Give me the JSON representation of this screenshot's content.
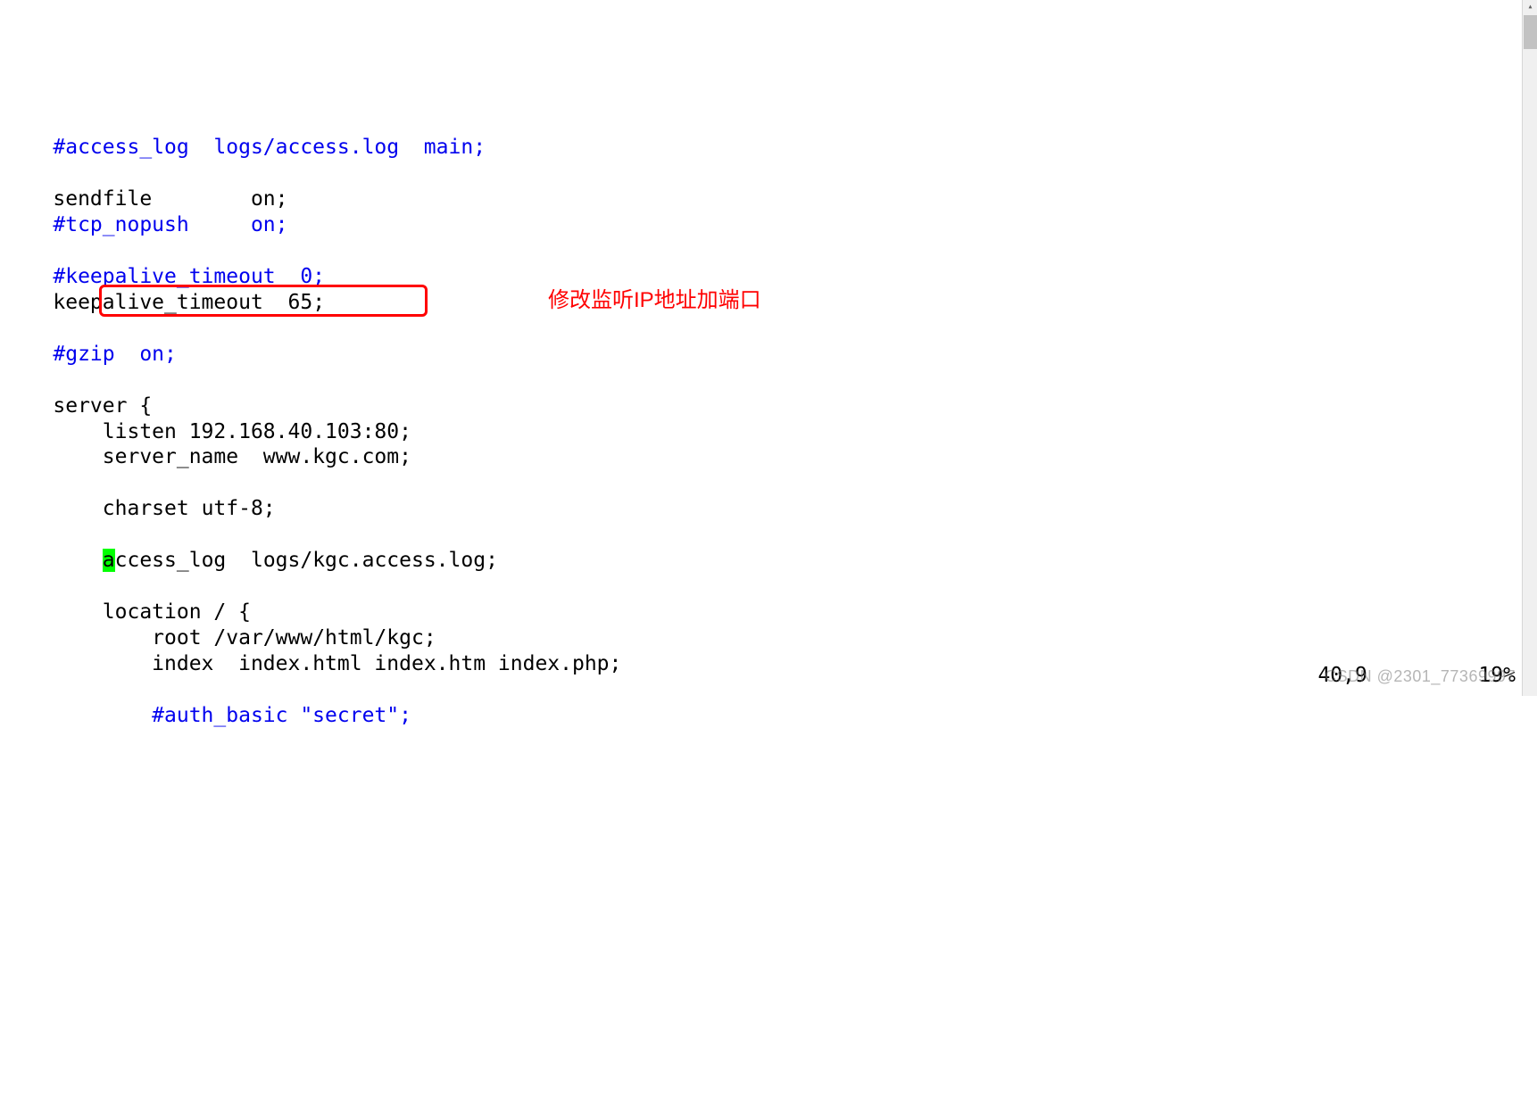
{
  "indent1": "    ",
  "indent2": "        ",
  "indent3": "            ",
  "lines": {
    "l1": {
      "comment": "#access_log  logs/access.log  main;"
    },
    "l2": {
      "key": "sendfile",
      "pad": "        ",
      "val": "on;"
    },
    "l3": {
      "comment": "#tcp_nopush     on;"
    },
    "l4": {
      "comment": "#keepalive_timeout  0;"
    },
    "l5": {
      "key": "keepalive_timeout  ",
      "val": "65;"
    },
    "l6": {
      "comment": "#gzip  on;"
    },
    "l7a": "server ",
    "l7b": "{",
    "l8": "listen 192.168.40.103:80;",
    "l9": {
      "key": "server_name  ",
      "val": "www.kgc.com;"
    },
    "l10": {
      "key": "charset ",
      "val": "utf-8;"
    },
    "l11a": "a",
    "l11b": "ccess_log  ",
    "l11c": "logs/kgc.access.log;",
    "l12a": "location ",
    "l12b": "/ ",
    "l12c": "{",
    "l13": {
      "key": "root ",
      "val": "/var/www/html/kgc;"
    },
    "l14": {
      "key": "index  ",
      "val": "index.html index.htm index.php;"
    },
    "l15": {
      "comment": "#auth_basic \"secret\";"
    }
  },
  "annotation": "修改监听IP地址加端口",
  "status": {
    "pos": "40,9",
    "gap": "         ",
    "pct": "19%"
  },
  "watermark": "CSDN @2301_77369997"
}
